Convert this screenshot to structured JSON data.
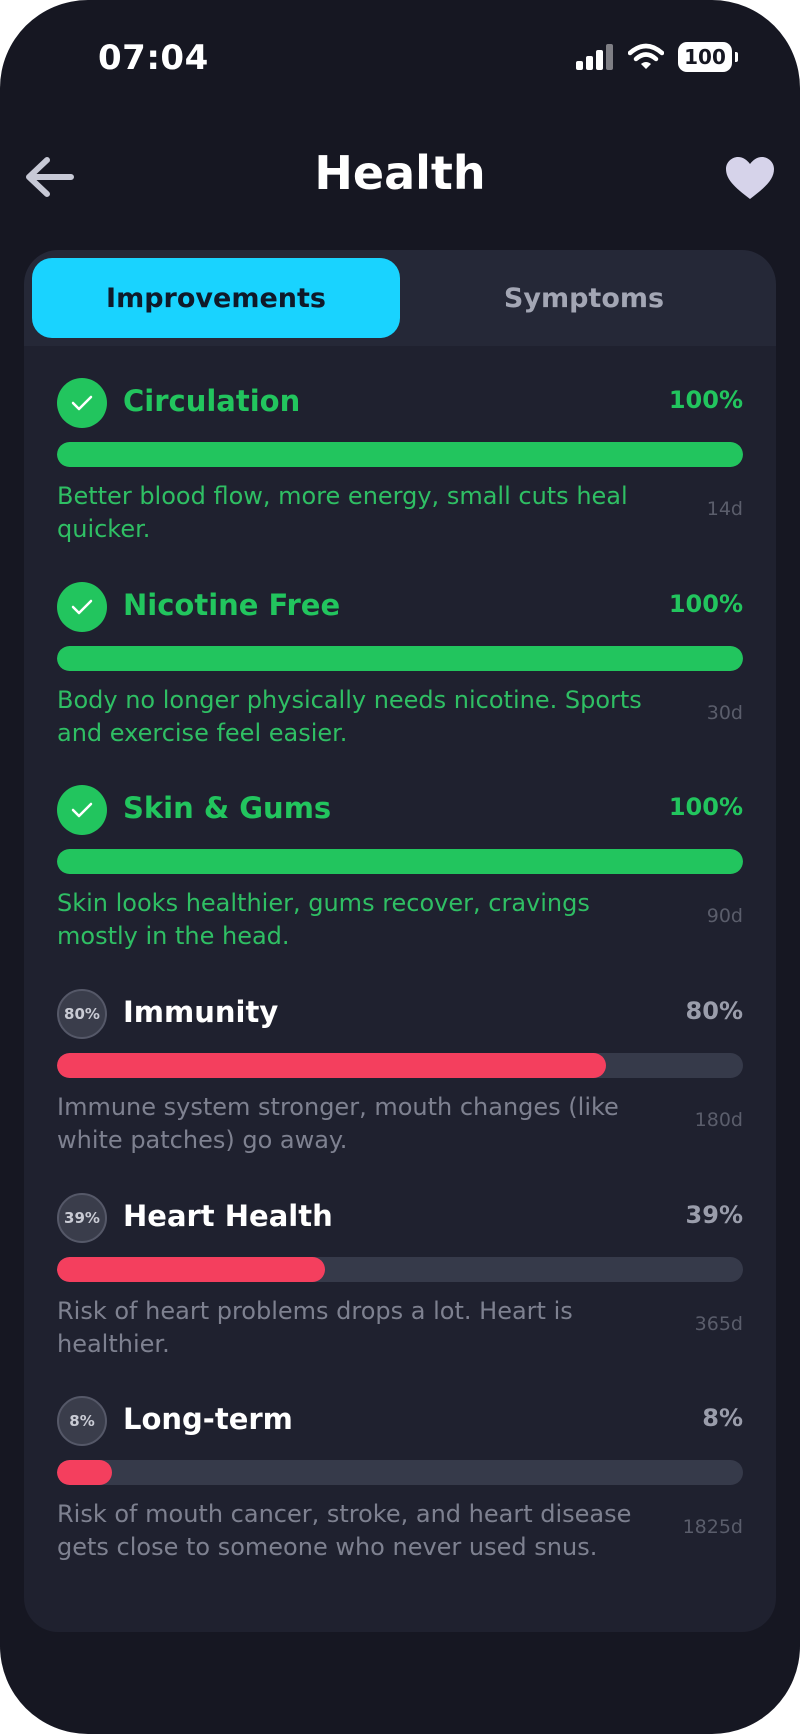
{
  "status_bar": {
    "time": "07:04",
    "battery": "100",
    "signal_icon": "signal-bars-icon",
    "wifi_icon": "wifi-icon"
  },
  "header": {
    "title": "Health",
    "back_icon": "back-arrow-icon",
    "favorite_icon": "heart-icon"
  },
  "tabs": [
    {
      "label": "Improvements",
      "active": true
    },
    {
      "label": "Symptoms",
      "active": false
    }
  ],
  "colors": {
    "accent": "#19d3ff",
    "complete": "#22c55e",
    "in_progress": "#f43f5e",
    "background": "#161722"
  },
  "improvements": [
    {
      "title": "Circulation",
      "percent_label": "100%",
      "progress": 1.0,
      "badge": "check-icon",
      "description": "Better blood flow, more energy, small cuts heal quicker.",
      "days": "14d"
    },
    {
      "title": "Nicotine Free",
      "percent_label": "100%",
      "progress": 1.0,
      "badge": "check-icon",
      "description": "Body no longer physically needs nicotine. Sports and exercise feel easier.",
      "days": "30d"
    },
    {
      "title": "Skin & Gums",
      "percent_label": "100%",
      "progress": 1.0,
      "badge": "check-icon",
      "description": "Skin looks healthier, gums recover, cravings mostly in the head.",
      "days": "90d"
    },
    {
      "title": "Immunity",
      "percent_label": "80%",
      "progress": 0.8,
      "badge_text": "80%",
      "description": "Immune system stronger, mouth changes (like white patches) go away.",
      "days": "180d"
    },
    {
      "title": "Heart Health",
      "percent_label": "39%",
      "progress": 0.39,
      "badge_text": "39%",
      "description": "Risk of heart problems drops a lot. Heart is healthier.",
      "days": "365d"
    },
    {
      "title": "Long-term",
      "percent_label": "8%",
      "progress": 0.08,
      "badge_text": "8%",
      "description": "Risk of mouth cancer, stroke, and heart disease gets close to someone who never used snus.",
      "days": "1825d"
    }
  ]
}
